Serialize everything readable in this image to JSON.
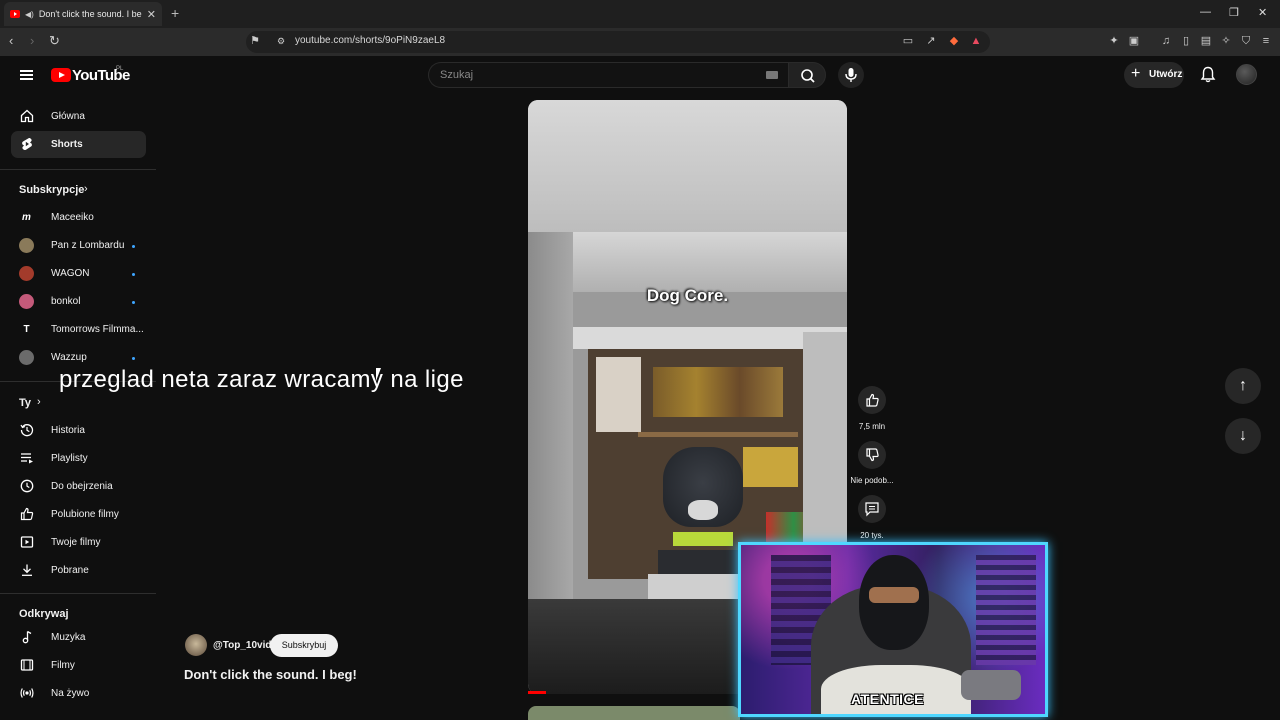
{
  "browser": {
    "tab_title": "Don't click the sound. I beg!",
    "url": "youtube.com/shorts/9oPiN9zaeL8"
  },
  "header": {
    "logo_text": "YouTube",
    "region": "PL",
    "search_placeholder": "Szukaj",
    "create_label": "Utwórz"
  },
  "sidebar": {
    "main": [
      {
        "label": "Główna",
        "icon": "home-icon"
      },
      {
        "label": "Shorts",
        "icon": "shorts-icon",
        "active": true
      }
    ],
    "subscriptions_heading": "Subskrypcje",
    "subscriptions": [
      {
        "label": "Maceeiko",
        "avatar_color": "#1a1a1a",
        "new": false
      },
      {
        "label": "Pan z Lombardu",
        "avatar_color": "#8a7a5a",
        "new": true
      },
      {
        "label": "WAGON",
        "avatar_color": "#a33b2b",
        "new": true
      },
      {
        "label": "bonkol",
        "avatar_color": "#c45a7a",
        "new": true
      },
      {
        "label": "Tomorrows Filmma...",
        "avatar_color": "#1a1a1a",
        "new": false
      },
      {
        "label": "Wazzup",
        "avatar_color": "#6b6b6b",
        "new": true
      }
    ],
    "you_heading": "Ty",
    "you": [
      {
        "label": "Historia",
        "icon": "history-icon"
      },
      {
        "label": "Playlisty",
        "icon": "playlist-icon"
      },
      {
        "label": "Do obejrzenia",
        "icon": "clock-icon"
      },
      {
        "label": "Polubione filmy",
        "icon": "thumbs-up-icon"
      },
      {
        "label": "Twoje filmy",
        "icon": "video-icon"
      },
      {
        "label": "Pobrane",
        "icon": "download-icon"
      }
    ],
    "explore_heading": "Odkrywaj",
    "explore": [
      {
        "label": "Muzyka",
        "icon": "music-icon"
      },
      {
        "label": "Filmy",
        "icon": "film-icon"
      },
      {
        "label": "Na żywo",
        "icon": "live-icon"
      }
    ]
  },
  "overlay_text": "przeglad neta zaraz wracamy na lige",
  "video": {
    "caption": "Dog Core.",
    "progress": 0.05
  },
  "actions": {
    "likes": "7,5 mln",
    "dislike_label": "Nie podob...",
    "comments": "20 tys."
  },
  "channel": {
    "handle": "@Top_10vid",
    "subscribe_label": "Subskrybuj",
    "title": "Don't click the sound. I beg!"
  },
  "webcam": {
    "label": "ATENTICE"
  }
}
